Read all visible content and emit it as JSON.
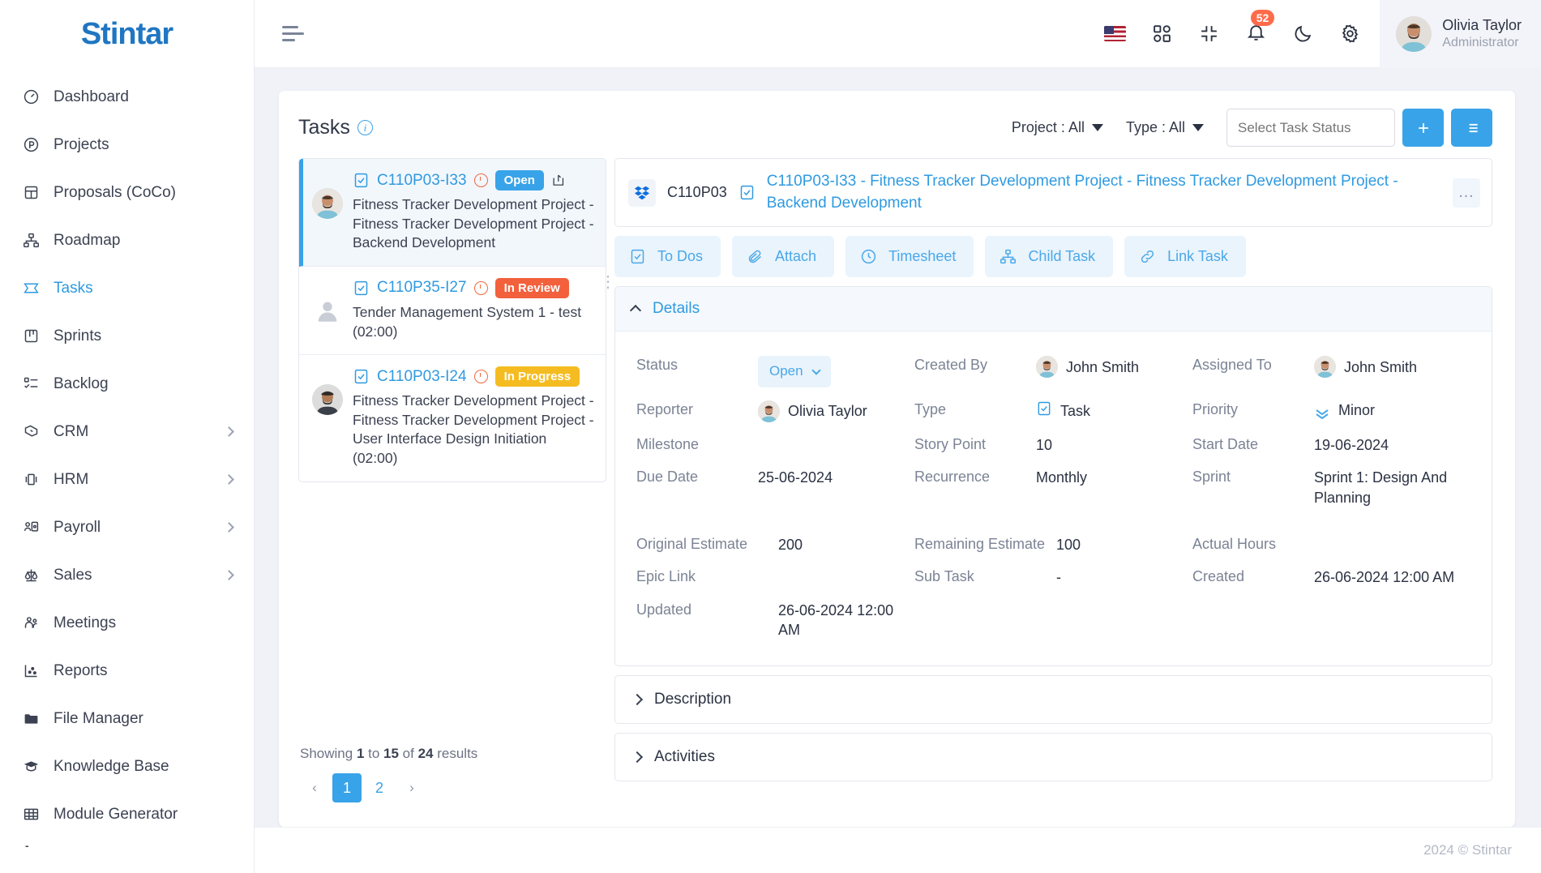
{
  "brand": {
    "name": "Stintar"
  },
  "sidebar": {
    "items": [
      {
        "label": "Dashboard",
        "icon": "gauge-icon",
        "active": false,
        "expandable": false
      },
      {
        "label": "Projects",
        "icon": "circle-p-icon",
        "active": false,
        "expandable": false
      },
      {
        "label": "Proposals (CoCo)",
        "icon": "layout-icon",
        "active": false,
        "expandable": false
      },
      {
        "label": "Roadmap",
        "icon": "hierarchy-icon",
        "active": false,
        "expandable": false
      },
      {
        "label": "Tasks",
        "icon": "ticket-icon",
        "active": true,
        "expandable": false
      },
      {
        "label": "Sprints",
        "icon": "board-icon",
        "active": false,
        "expandable": false
      },
      {
        "label": "Backlog",
        "icon": "checklist-icon",
        "active": false,
        "expandable": false
      },
      {
        "label": "CRM",
        "icon": "handshake-icon",
        "active": false,
        "expandable": true
      },
      {
        "label": "HRM",
        "icon": "badge-icon",
        "active": false,
        "expandable": true
      },
      {
        "label": "Payroll",
        "icon": "user-card-icon",
        "active": false,
        "expandable": true
      },
      {
        "label": "Sales",
        "icon": "scales-icon",
        "active": false,
        "expandable": true
      },
      {
        "label": "Meetings",
        "icon": "people-icon",
        "active": false,
        "expandable": false
      },
      {
        "label": "Reports",
        "icon": "scatter-chart-icon",
        "active": false,
        "expandable": false
      },
      {
        "label": "File Manager",
        "icon": "folder-icon",
        "active": false,
        "expandable": false
      },
      {
        "label": "Knowledge Base",
        "icon": "graduation-cap-icon",
        "active": false,
        "expandable": false
      },
      {
        "label": "Module Generator",
        "icon": "grid-table-icon",
        "active": false,
        "expandable": false
      }
    ]
  },
  "topbar": {
    "menu_icon": "hamburger-icon",
    "language_flag": "us-flag-icon",
    "apps_icon": "apps-grid-icon",
    "fullscreen_icon": "compress-icon",
    "notifications_icon": "bell-icon",
    "notifications_count": "52",
    "theme_icon": "moon-icon",
    "settings_icon": "gear-icon",
    "user": {
      "name": "Olivia Taylor",
      "role": "Administrator"
    }
  },
  "page": {
    "title": "Tasks",
    "info_icon": "info-icon"
  },
  "filters": {
    "project": "Project : All",
    "type": "Type : All",
    "status_placeholder": "Select Task Status",
    "status_value": "",
    "add_button_icon": "plus-icon",
    "list_button_icon": "list-icon"
  },
  "task_list": {
    "items": [
      {
        "key": "C110P03-I33",
        "status": "Open",
        "status_kind": "open",
        "description": "Fitness Tracker Development Project - Fitness Tracker Development Project - Backend Development",
        "selected": true,
        "has_avatar": true,
        "has_share": true
      },
      {
        "key": "C110P35-I27",
        "status": "In Review",
        "status_kind": "review",
        "description": "Tender Management System 1 - test (02:00)",
        "selected": false,
        "has_avatar": false,
        "has_share": false
      },
      {
        "key": "C110P03-I24",
        "status": "In Progress",
        "status_kind": "progress",
        "description": "Fitness Tracker Development Project - Fitness Tracker Development Project - User Interface Design Initiation (02:00)",
        "selected": false,
        "has_avatar": true,
        "has_share": false
      }
    ],
    "showing_text": "Showing 1 to 15 of 24 results",
    "showing_parts": {
      "prefix": "Showing ",
      "from": "1",
      "mid": " to ",
      "to": "15",
      "mid2": " of ",
      "total": "24",
      "suffix": " results"
    },
    "pagination": {
      "prev": "‹",
      "pages": [
        "1",
        "2"
      ],
      "active": "1",
      "next": "›"
    }
  },
  "detail": {
    "project_code": "C110P03",
    "project_icon": "dropbox-icon",
    "task_type_icon": "task-check-icon",
    "title": "C110P03-I33 - Fitness Tracker Development Project - Fitness Tracker Development Project - Backend Development",
    "more_menu": "…",
    "tabs": [
      {
        "label": "To Dos",
        "icon": "todo-check-icon"
      },
      {
        "label": "Attach",
        "icon": "paperclip-icon"
      },
      {
        "label": "Timesheet",
        "icon": "clock-icon"
      },
      {
        "label": "Child Task",
        "icon": "hierarchy-icon"
      },
      {
        "label": "Link Task",
        "icon": "link-icon"
      }
    ],
    "details_section": {
      "label": "Details",
      "expanded": true,
      "fields": {
        "status_label": "Status",
        "status_value": "Open",
        "created_by_label": "Created By",
        "created_by_value": "John Smith",
        "assigned_to_label": "Assigned To",
        "assigned_to_value": "John Smith",
        "reporter_label": "Reporter",
        "reporter_value": "Olivia Taylor",
        "type_label": "Type",
        "type_value": "Task",
        "priority_label": "Priority",
        "priority_value": "Minor",
        "milestone_label": "Milestone",
        "milestone_value": "",
        "story_point_label": "Story Point",
        "story_point_value": "10",
        "start_date_label": "Start Date",
        "start_date_value": "19-06-2024",
        "due_date_label": "Due Date",
        "due_date_value": "25-06-2024",
        "recurrence_label": "Recurrence",
        "recurrence_value": "Monthly",
        "sprint_label": "Sprint",
        "sprint_value": "Sprint 1: Design And Planning",
        "original_estimate_label": "Original Estimate",
        "original_estimate_value": "200",
        "remaining_estimate_label": "Remaining Estimate",
        "remaining_estimate_value": "100",
        "actual_hours_label": "Actual Hours",
        "actual_hours_value": "",
        "epic_link_label": "Epic Link",
        "epic_link_value": "",
        "sub_task_label": "Sub Task",
        "sub_task_value": "-",
        "created_label": "Created",
        "created_value": "26-06-2024 12:00 AM",
        "updated_label": "Updated",
        "updated_value": "26-06-2024 12:00 AM"
      }
    },
    "description_section": {
      "label": "Description",
      "expanded": false
    },
    "activities_section": {
      "label": "Activities",
      "expanded": false
    }
  },
  "footer": {
    "copyright": "2024 © Stintar"
  },
  "colors": {
    "accent": "#38a3e8",
    "open": "#38a3e8",
    "in_review": "#f2603c",
    "in_progress": "#f5bc21",
    "badge": "#ff6b4a",
    "sidebar_bg": "#ffffff",
    "page_bg": "#f1f2f7"
  }
}
